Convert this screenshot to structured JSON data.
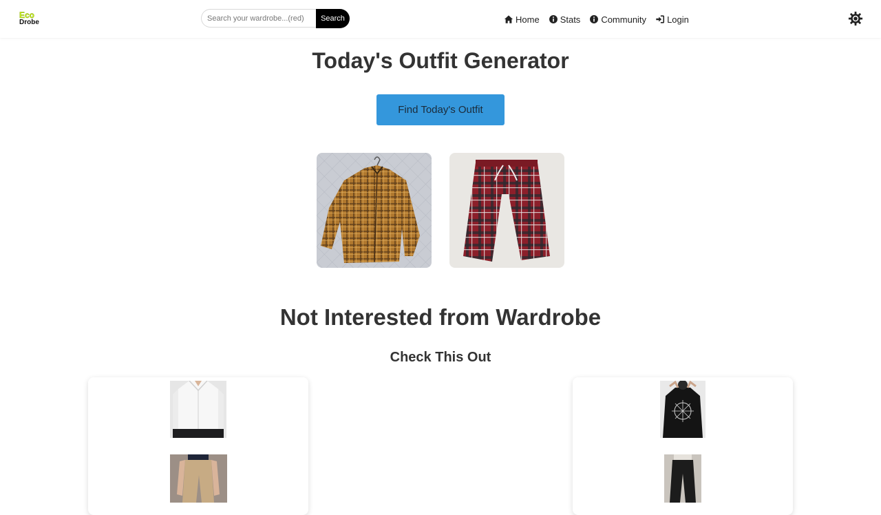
{
  "brand": {
    "line1": "Eco",
    "line2": "Drobe"
  },
  "search": {
    "placeholder": "Search your wardrobe...(red)",
    "button_label": "Search"
  },
  "nav": {
    "items": [
      {
        "label": "Home",
        "icon": "home-icon"
      },
      {
        "label": "Stats",
        "icon": "info-circle-icon"
      },
      {
        "label": "Community",
        "icon": "info-circle-icon"
      },
      {
        "label": "Login",
        "icon": "sign-in-icon"
      }
    ],
    "theme_toggle_icon": "sun-gear-icon"
  },
  "main": {
    "title": "Today's Outfit Generator",
    "find_button_label": "Find Today's Outfit",
    "outfit_items": [
      {
        "name": "brown plaid shirt"
      },
      {
        "name": "red plaid pants"
      }
    ],
    "section_title": "Not Interested from Wardrobe",
    "section_subtitle": "Check This Out"
  },
  "colors": {
    "accent": "#3497dc",
    "search_button": "#000000",
    "logo_green": "#c6f31b",
    "text": "#333333"
  }
}
